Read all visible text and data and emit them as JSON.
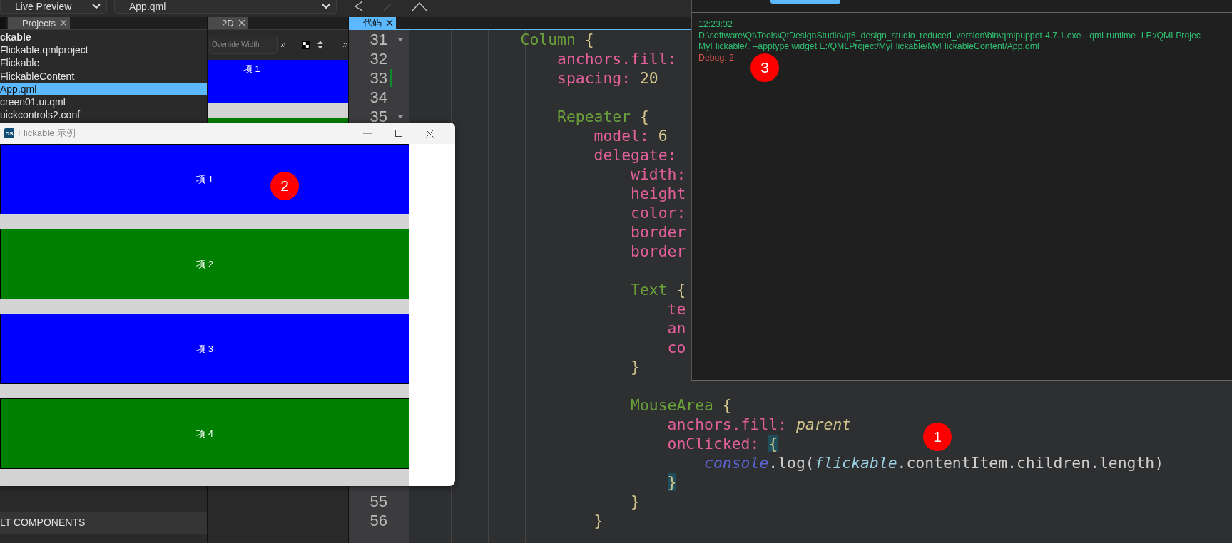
{
  "toolbar": {
    "preview_mode": "Live Preview",
    "document": "App.qml"
  },
  "projects_panel": {
    "tab": {
      "label": "Projects",
      "selected": false
    },
    "tree": [
      {
        "label": "ckable",
        "selected": false,
        "children": [
          {
            "label": "Flickable.qmlproject",
            "selected": false
          },
          {
            "label": "Flickable",
            "selected": false
          },
          {
            "label": "FlickableContent",
            "selected": false
          },
          {
            "label": "App.qml",
            "selected": true
          },
          {
            "label": "creen01.ui.qml",
            "selected": false
          },
          {
            "label": "uickcontrols2.conf",
            "selected": false
          }
        ]
      }
    ],
    "section_header": "LT COMPONENTS"
  },
  "design_panel": {
    "tab": {
      "label": "2D",
      "selected": false
    },
    "override_width": {
      "placeholder": "Override Width"
    },
    "preview_items": [
      {
        "label": "项 1",
        "color": "#0000ff"
      },
      {
        "color": "#008000"
      }
    ]
  },
  "editor": {
    "tab": {
      "label": "代码",
      "selected": true
    },
    "lines": [
      {
        "number": "31",
        "foldable": true,
        "modified": false,
        "tokens": [
          {
            "kind": "type",
            "text": "            Column"
          },
          {
            "kind": "brace",
            "text": " {"
          }
        ]
      },
      {
        "number": "32",
        "foldable": false,
        "modified": false,
        "tokens": [
          {
            "kind": "prop",
            "text": "                anchors.fill:"
          }
        ]
      },
      {
        "number": "33",
        "foldable": false,
        "modified": true,
        "tokens": [
          {
            "kind": "prop",
            "text": "                spacing:"
          },
          {
            "kind": "num",
            "text": " 20"
          }
        ]
      },
      {
        "number": "34",
        "foldable": false,
        "modified": false
      },
      {
        "number": "35",
        "foldable": true,
        "modified": false,
        "tokens": [
          {
            "kind": "type",
            "text": "                Repeater"
          },
          {
            "kind": "brace",
            "text": " {"
          }
        ]
      },
      {
        "tokens": [
          {
            "kind": "prop",
            "text": "                    model:"
          },
          {
            "kind": "num",
            "text": " 6"
          }
        ]
      },
      {
        "tokens": [
          {
            "kind": "prop",
            "text": "                    delegate:"
          }
        ]
      },
      {
        "tokens": [
          {
            "kind": "prop",
            "text": "                        width:"
          }
        ]
      },
      {
        "tokens": [
          {
            "kind": "prop",
            "text": "                        height"
          }
        ]
      },
      {
        "tokens": [
          {
            "kind": "prop",
            "text": "                        color:"
          }
        ]
      },
      {
        "tokens": [
          {
            "kind": "prop",
            "text": "                        border"
          }
        ]
      },
      {
        "tokens": [
          {
            "kind": "prop",
            "text": "                        border"
          }
        ]
      },
      {
        "foldable": false,
        "modified": false
      },
      {
        "tokens": [
          {
            "kind": "type",
            "text": "                        Text"
          },
          {
            "kind": "brace",
            "text": " {"
          }
        ]
      },
      {
        "tokens": [
          {
            "kind": "prop",
            "text": "                            te"
          }
        ]
      },
      {
        "tokens": [
          {
            "kind": "prop",
            "text": "                            an"
          }
        ]
      },
      {
        "tokens": [
          {
            "kind": "prop",
            "text": "                            co"
          }
        ]
      },
      {
        "tokens": [
          {
            "kind": "brace",
            "text": "                        }"
          }
        ]
      },
      {
        "foldable": false,
        "modified": false
      },
      {
        "tokens": [
          {
            "kind": "type",
            "text": "                        MouseArea"
          },
          {
            "kind": "brace",
            "text": " {"
          }
        ]
      },
      {
        "tokens": [
          {
            "kind": "prop",
            "text": "                            anchors.fill:"
          },
          {
            "kind": "italic",
            "text": " parent"
          }
        ]
      },
      {
        "tokens": [
          {
            "kind": "prop",
            "text": "                            onClicked: "
          },
          {
            "kind": "match",
            "text": "{"
          }
        ]
      },
      {
        "tokens": [
          {
            "kind": "object",
            "text": "                                console"
          },
          {
            "kind": "plain",
            "text": ".log("
          },
          {
            "kind": "id",
            "text": "flickable"
          },
          {
            "kind": "plain",
            "text": ".contentItem.children.length)"
          }
        ]
      },
      {
        "tokens": [
          {
            "kind": "match",
            "text": "                            }"
          }
        ]
      },
      {
        "number": "55",
        "foldable": false,
        "modified": false,
        "tokens": [
          {
            "kind": "brace",
            "text": "                        }"
          }
        ]
      },
      {
        "number": "56",
        "foldable": false,
        "modified": false,
        "tokens": [
          {
            "kind": "brace",
            "text": "                    }"
          }
        ]
      }
    ]
  },
  "output_panel": {
    "lines": [
      {
        "kind": "info",
        "text": "12:23:32"
      },
      {
        "kind": "info",
        "text": "D:\\software\\Qt\\Tools\\QtDesignStudio\\qt6_design_studio_reduced_version\\bin\\qmlpuppet-4.7.1.exe --qml-runtime -I E:/QMLProjec"
      },
      {
        "kind": "info",
        "text": "MyFlickable/. --apptype widget E:/QMLProject/MyFlickable/MyFlickableContent/App.qml"
      },
      {
        "kind": "debug",
        "text": "Debug: 2"
      }
    ]
  },
  "preview_window": {
    "logo": "DS",
    "title": "Flickable 示例",
    "items": [
      {
        "label": "项 1",
        "color": "#0000ff"
      },
      {
        "label": "项 2",
        "color": "#008000"
      },
      {
        "label": "项 3",
        "color": "#0000ff"
      },
      {
        "label": "项 4",
        "color": "#008000"
      }
    ]
  },
  "annotations": [
    {
      "number": "1"
    },
    {
      "number": "2"
    },
    {
      "number": "3"
    }
  ]
}
